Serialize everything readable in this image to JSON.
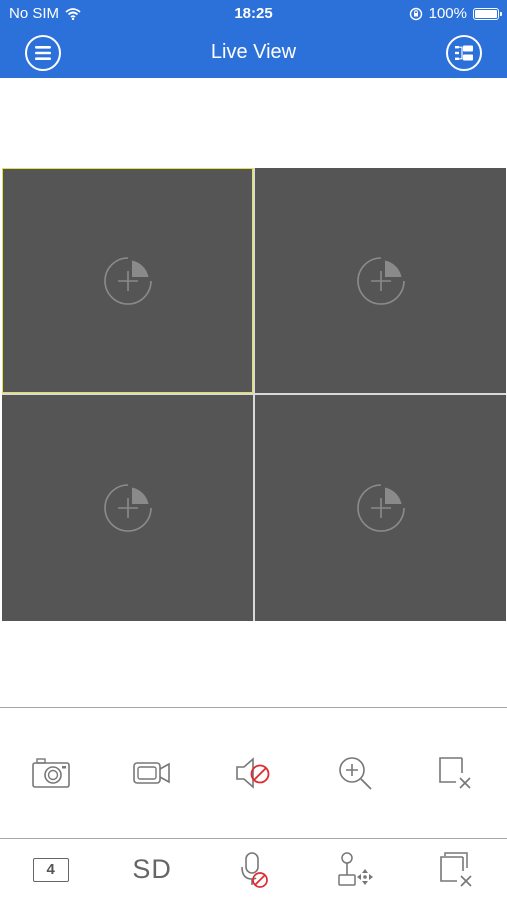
{
  "status_bar": {
    "carrier": "No SIM",
    "time": "18:25",
    "battery_percent": "100%",
    "battery_level": 1.0
  },
  "nav": {
    "title": "Live View",
    "menu_icon": "menu-icon",
    "device_list_icon": "device-list-icon"
  },
  "grid": {
    "layout": "2x2",
    "selected_index": 0,
    "cells": [
      {
        "icon": "add-camera-icon"
      },
      {
        "icon": "add-camera-icon"
      },
      {
        "icon": "add-camera-icon"
      },
      {
        "icon": "add-camera-icon"
      }
    ]
  },
  "toolbar_top": [
    {
      "name": "snapshot",
      "icon": "camera-icon"
    },
    {
      "name": "record",
      "icon": "video-record-icon"
    },
    {
      "name": "audio",
      "icon": "speaker-muted-icon"
    },
    {
      "name": "digital-zoom",
      "icon": "zoom-in-icon"
    },
    {
      "name": "close-window",
      "icon": "close-window-icon"
    }
  ],
  "toolbar_bottom": {
    "split_count": "4",
    "stream_label": "SD",
    "talk_icon": "microphone-muted-icon",
    "ptz_icon": "ptz-joystick-icon",
    "close_all_icon": "close-all-windows-icon"
  },
  "colors": {
    "brand_blue": "#2b71d9",
    "cell_bg": "#555555",
    "selected_border": "#e5e04a",
    "icon_gray": "#777777",
    "mute_red": "#e0282e"
  }
}
